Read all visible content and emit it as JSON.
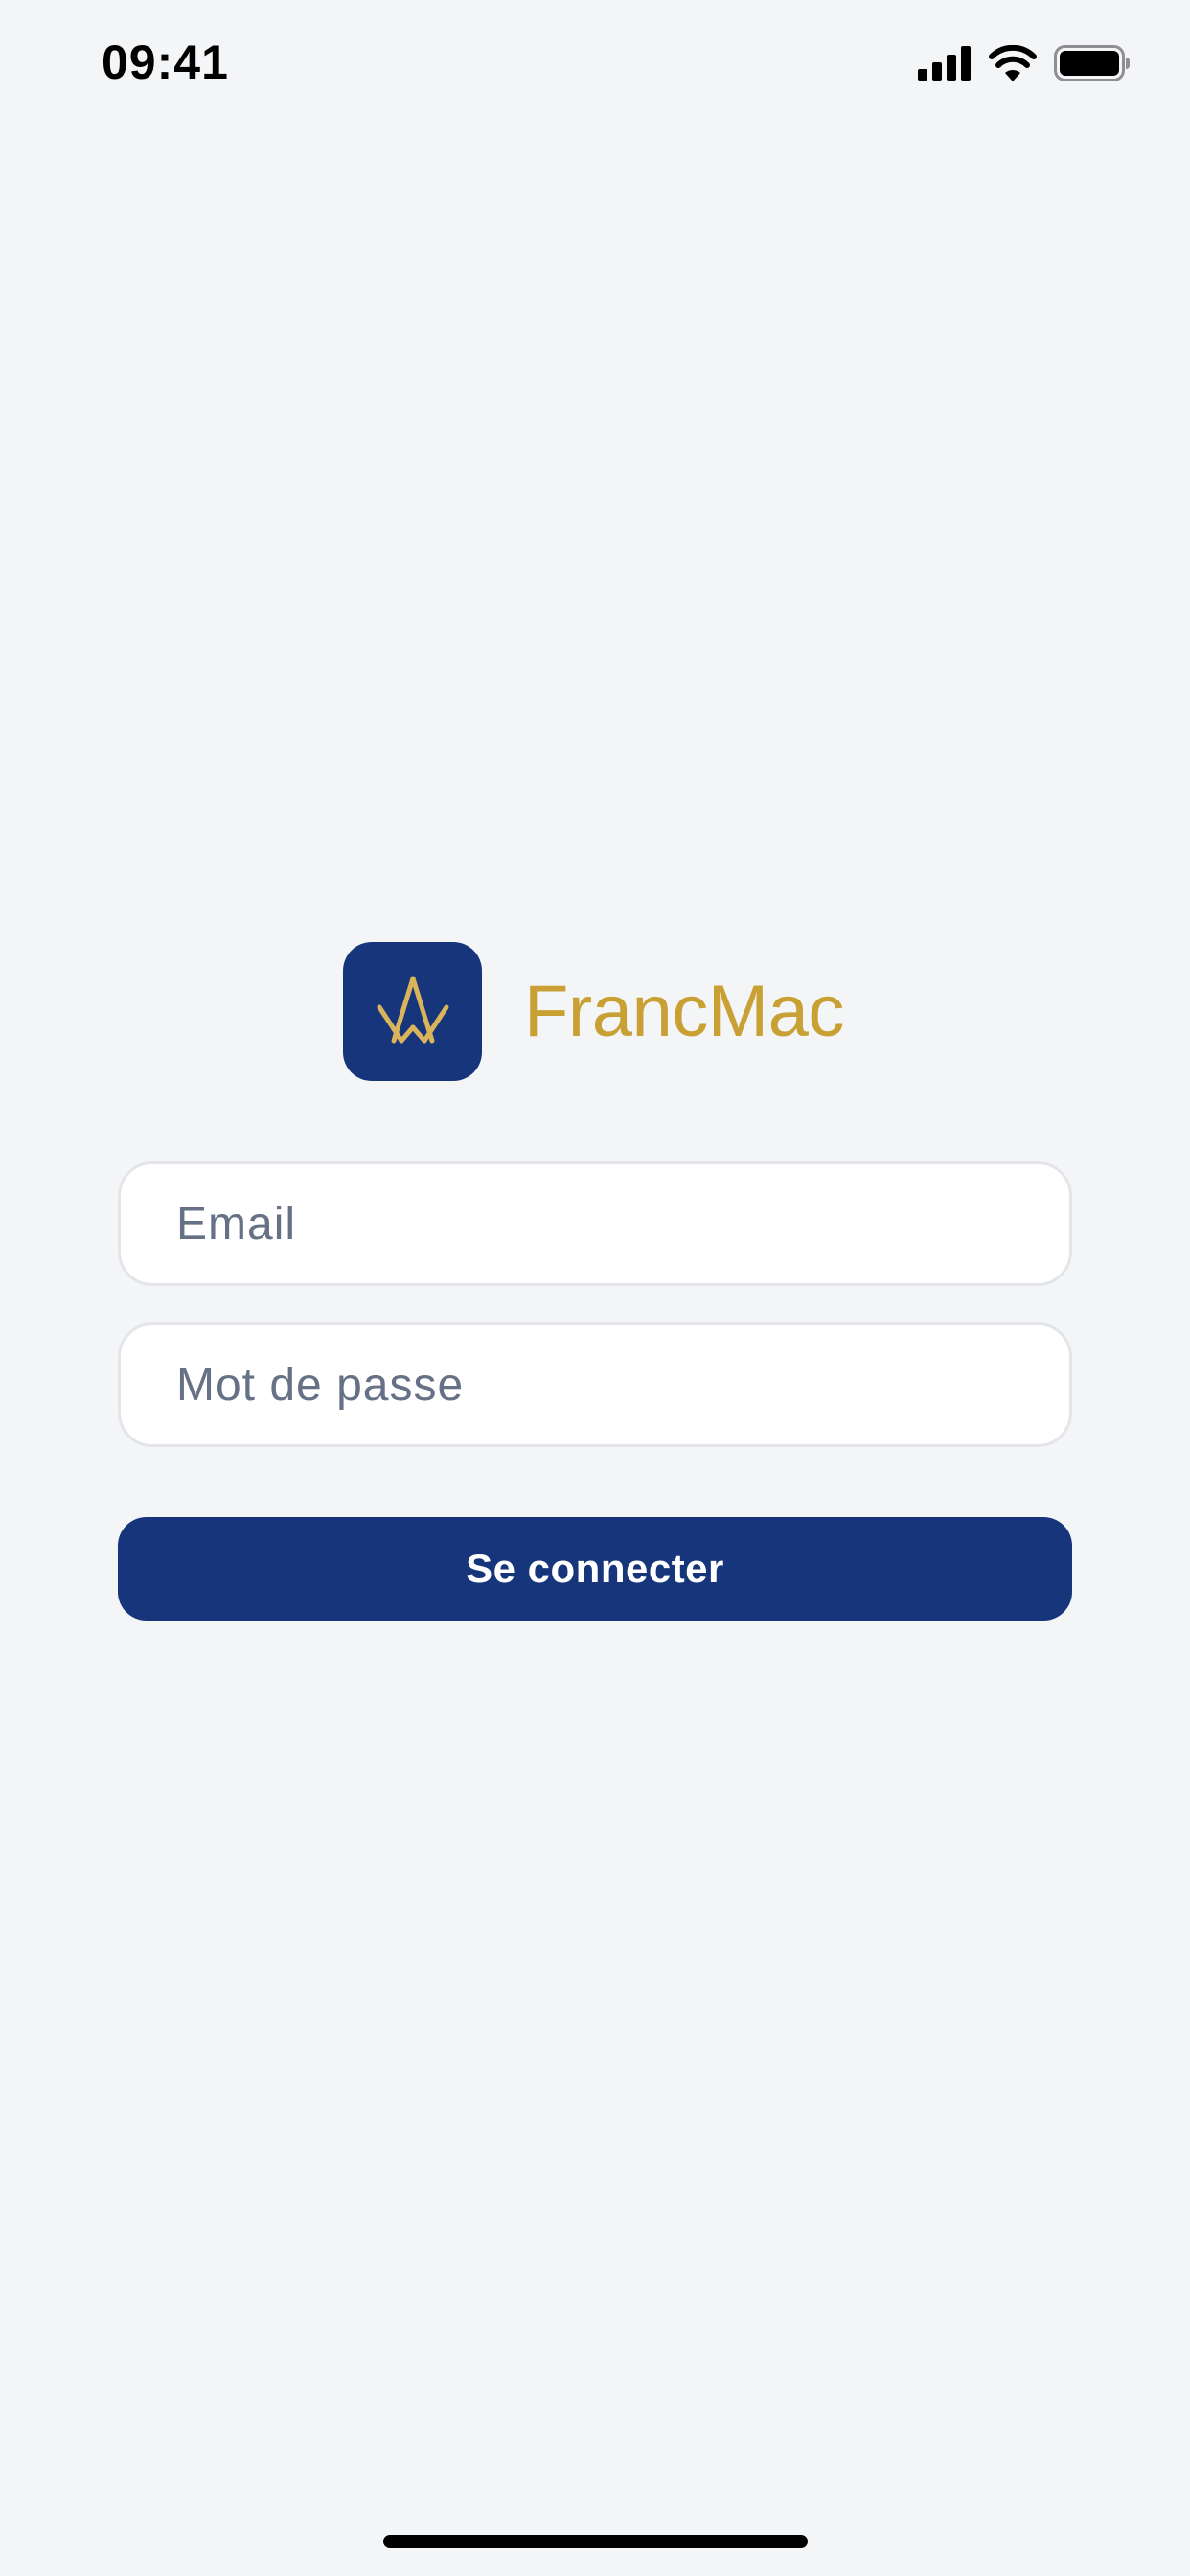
{
  "status_bar": {
    "time": "09:41",
    "icons": [
      "cellular-signal-icon",
      "wifi-icon",
      "battery-icon"
    ]
  },
  "brand": {
    "logo_icon": "compass-square-logo",
    "name": "FrancMac"
  },
  "form": {
    "email_placeholder": "Email",
    "email_value": "",
    "password_placeholder": "Mot de passe",
    "password_value": "",
    "submit_label": "Se connecter"
  },
  "colors": {
    "background": "#f4f5f7",
    "primary": "#16357a",
    "accent_gold": "#c9a033",
    "placeholder": "#667185",
    "field_border": "#e3e5e9"
  }
}
